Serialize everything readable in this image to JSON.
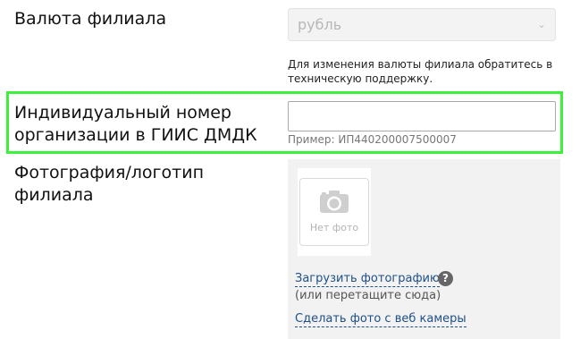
{
  "currency": {
    "label": "Валюта филиала",
    "selected": "рубль",
    "help_line1": "Для изменения валюты филиала обратитесь в",
    "help_line2": "техническую поддержку."
  },
  "giis": {
    "label_line1": "Индивидуальный номер",
    "label_line2": "организации в ГИИС ДМДК",
    "value": "",
    "example": "Пример: ИП440200007500007"
  },
  "photo": {
    "label_line1": "Фотография/логотип",
    "label_line2": "филиала",
    "placeholder_text": "Нет фото",
    "upload_link": "Загрузить фотографию",
    "help_icon": "?",
    "drop_hint": "(или перетащите сюда)",
    "webcam_link": "Сделать фото с веб камеры"
  },
  "colors": {
    "highlight": "#3cf03c",
    "link": "#1e4f86"
  }
}
